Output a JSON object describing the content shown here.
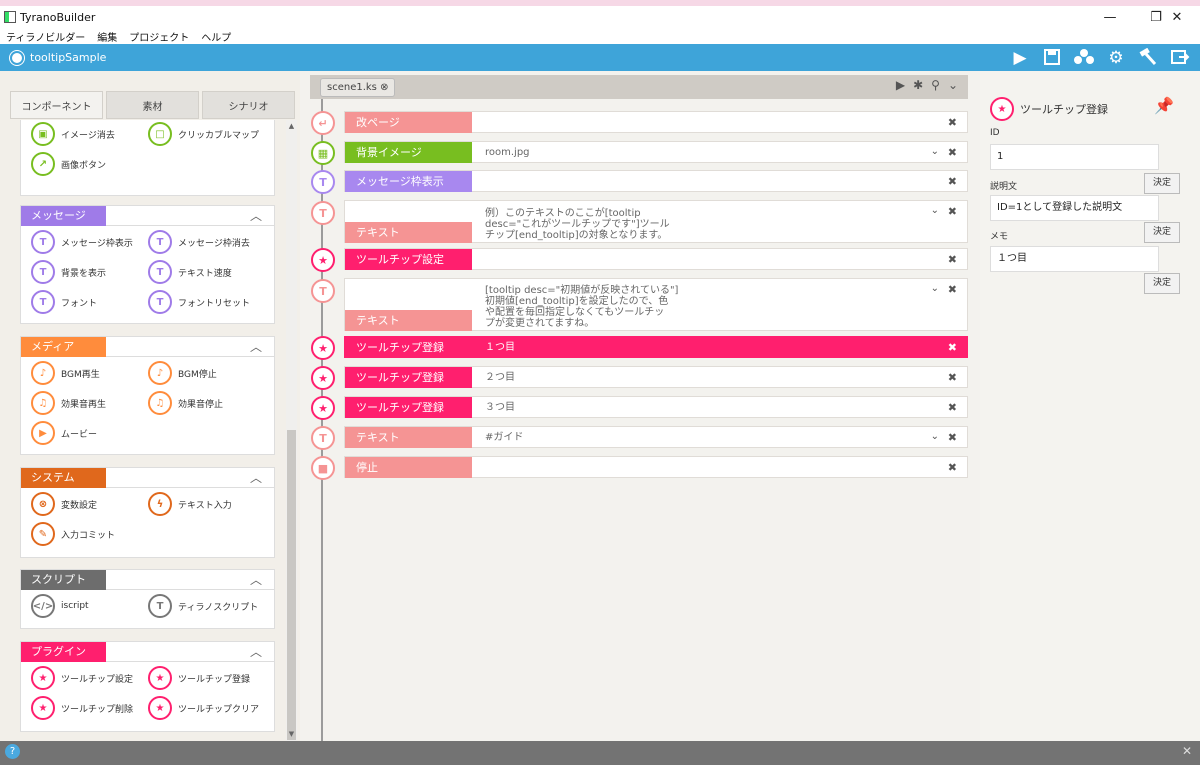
{
  "window": {
    "title": "TyranoBuilder",
    "controls": {
      "minimize": "—",
      "maximize": "❐",
      "close": "✕"
    }
  },
  "menu": [
    "ティラノビルダー",
    "編集",
    "プロジェクト",
    "ヘルプ"
  ],
  "project": {
    "name": "tooltipSample"
  },
  "toolbar_icons": [
    "play-icon",
    "save-icon",
    "users-icon",
    "gear-icon",
    "hammer-icon",
    "export-icon"
  ],
  "left_tabs": [
    "コンポーネント",
    "素材",
    "シナリオ"
  ],
  "component_groups": {
    "image": {
      "items": [
        "イメージ消去",
        "クリッカブルマップ",
        "画像ボタン"
      ]
    },
    "message": {
      "title": "メッセージ",
      "color": "#9f7be8",
      "items": [
        "メッセージ枠表示",
        "メッセージ枠消去",
        "背景を表示",
        "テキスト速度",
        "フォント",
        "フォントリセット"
      ]
    },
    "media": {
      "title": "メディア",
      "color": "#ff8c3c",
      "items": [
        "BGM再生",
        "BGM停止",
        "効果音再生",
        "効果音停止",
        "ムービー"
      ]
    },
    "system": {
      "title": "システム",
      "color": "#e0681c",
      "items": [
        "変数設定",
        "テキスト入力",
        "入力コミット"
      ]
    },
    "script": {
      "title": "スクリプト",
      "color": "#6d6d6d",
      "items": [
        "iscript",
        "ティラノスクリプト"
      ]
    },
    "plugin": {
      "title": "プラグイン",
      "color": "#ff1f6e",
      "items": [
        "ツールチップ設定",
        "ツールチップ登録",
        "ツールチップ削除",
        "ツールチップクリア"
      ]
    }
  },
  "editor": {
    "file_tab": "scene1.ks",
    "rows": [
      {
        "label": "改ページ",
        "param": "",
        "color": "#f59494"
      },
      {
        "label": "背景イメージ",
        "param": "room.jpg",
        "color": "#78be20"
      },
      {
        "label": "メッセージ枠表示",
        "param": "",
        "color": "#a888ef"
      },
      {
        "label": "テキスト",
        "param": "例）このテキストのここが[tooltip\ndesc=\"これがツールチップです\"]ツール\nチップ[end_tooltip]の対象となります。",
        "color": "#f59494"
      },
      {
        "label": "ツールチップ設定",
        "param": "",
        "color": "#ff1f6e"
      },
      {
        "label": "テキスト",
        "param": "[tooltip desc=\"初期値が反映されている\"]\n初期値[end_tooltip]を設定したので、色\nや配置を毎回指定しなくてもツールチッ\nプが変更されてますね。",
        "color": "#f59494"
      },
      {
        "label": "ツールチップ登録",
        "param": "１つ目",
        "color": "#ff1f6e"
      },
      {
        "label": "ツールチップ登録",
        "param": "２つ目",
        "color": "#ff1f6e"
      },
      {
        "label": "ツールチップ登録",
        "param": "３つ目",
        "color": "#ff1f6e"
      },
      {
        "label": "テキスト",
        "param": "#ガイド",
        "color": "#f59494"
      },
      {
        "label": "停止",
        "param": "",
        "color": "#f59494"
      }
    ]
  },
  "properties": {
    "title": "ツールチップ登録",
    "id_label": "ID",
    "id_value": "1",
    "desc_label": "説明文",
    "desc_value": "ID=1として登録した説明文",
    "memo_label": "メモ",
    "memo_value": "１つ目",
    "confirm": "決定"
  },
  "help": "?"
}
